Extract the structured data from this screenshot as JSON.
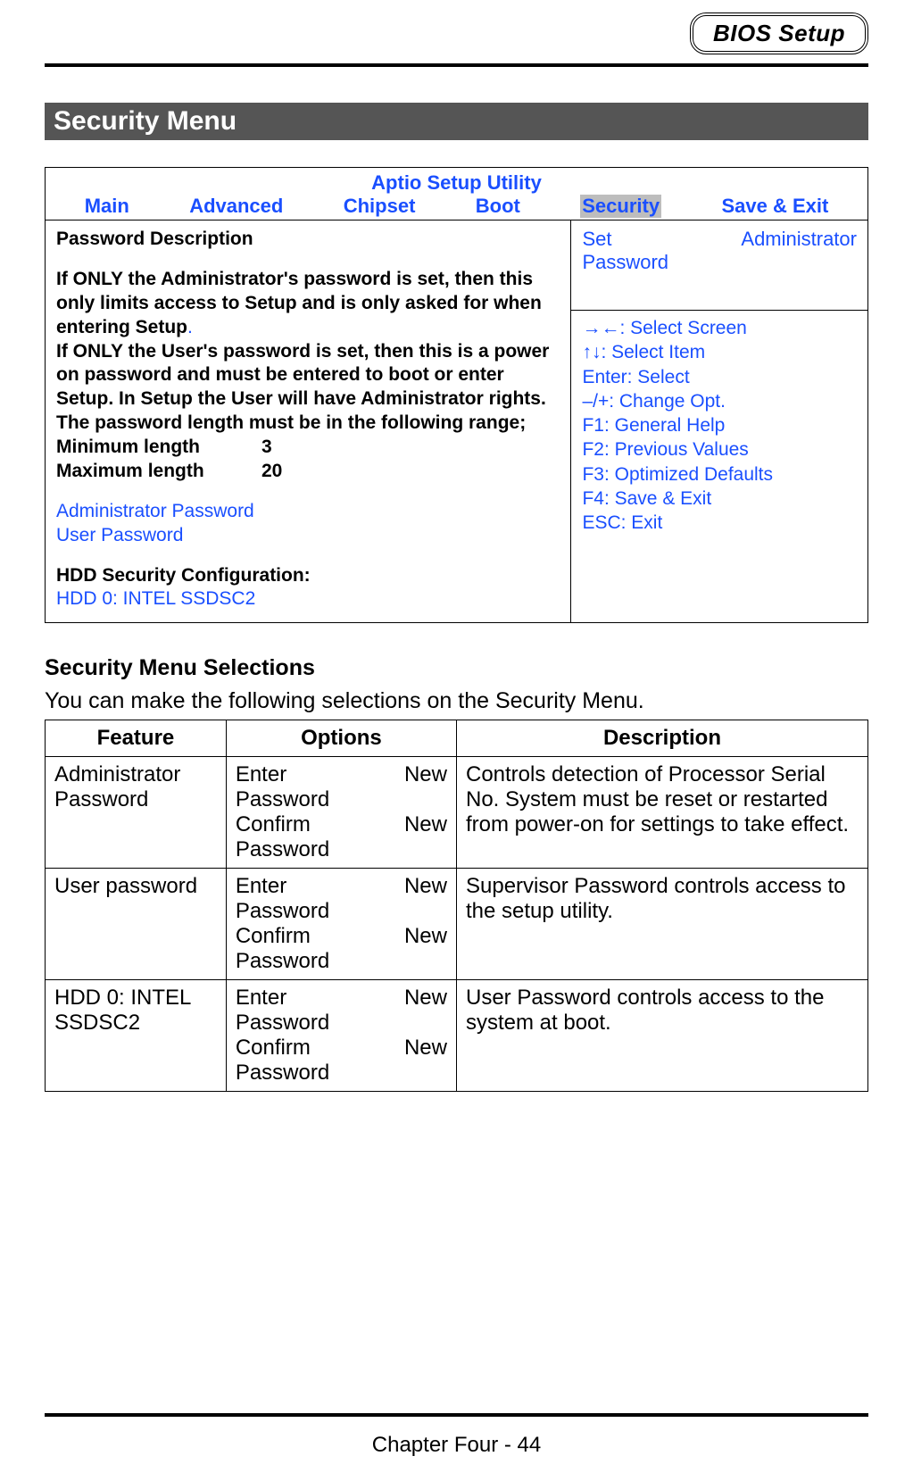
{
  "header": {
    "badge": "BIOS Setup"
  },
  "section_title": "Security Menu",
  "bios": {
    "title": "Aptio Setup Utility",
    "tabs": [
      "Main",
      "Advanced",
      "Chipset",
      "Boot",
      "Security",
      "Save & Exit"
    ],
    "selected_tab": "Security",
    "left": {
      "heading": "Password Description",
      "para1": "If ONLY the Administrator's password is set, then this only limits access to Setup and is only asked for when entering Setup",
      "para2": "If ONLY the User's password is set, then this is a power on password and must be entered to boot or enter Setup. In Setup the User will have Administrator rights.",
      "para3": "The password length must be in the following range;",
      "min_label": "Minimum length",
      "min_value": "3",
      "max_label": "Maximum length",
      "max_value": "20",
      "admin_pw": "Administrator Password",
      "user_pw": "User Password",
      "hdd_heading": "HDD Security Configuration:",
      "hdd_item": "HDD 0: INTEL SSDSC2"
    },
    "right_top": {
      "label_left": "Set",
      "label_right": "Administrator",
      "label_below": "Password"
    },
    "help": [
      "→←: Select Screen",
      "↑↓: Select Item",
      "Enter: Select",
      "–/+: Change Opt.",
      "F1: General Help",
      "F2: Previous Values",
      "F3: Optimized Defaults",
      "F4: Save & Exit",
      "ESC: Exit"
    ]
  },
  "selections": {
    "header": "Security Menu Selections",
    "intro": "You can make the following selections on the Security Menu.",
    "columns": [
      "Feature",
      "Options",
      "Description"
    ],
    "rows": [
      {
        "feature": "Administrator Password",
        "options": [
          {
            "l": "Enter",
            "r": "New"
          },
          {
            "l": "Password",
            "r": ""
          },
          {
            "l": "Confirm",
            "r": "New"
          },
          {
            "l": "Password",
            "r": ""
          }
        ],
        "description": "Controls detection of Processor Serial No. System must be reset or restarted from power-on for settings to take effect."
      },
      {
        "feature": "User password",
        "options": [
          {
            "l": "Enter",
            "r": "New"
          },
          {
            "l": "Password",
            "r": ""
          },
          {
            "l": "Confirm",
            "r": "New"
          },
          {
            "l": "Password",
            "r": ""
          }
        ],
        "description": "Supervisor Password controls access to the setup utility."
      },
      {
        "feature": "HDD 0: INTEL SSDSC2",
        "options": [
          {
            "l": "Enter",
            "r": "New"
          },
          {
            "l": "Password",
            "r": ""
          },
          {
            "l": "Confirm",
            "r": "New"
          },
          {
            "l": "Password",
            "r": ""
          }
        ],
        "description": "User Password controls access to the system at boot."
      }
    ]
  },
  "footer": "Chapter Four - 44"
}
